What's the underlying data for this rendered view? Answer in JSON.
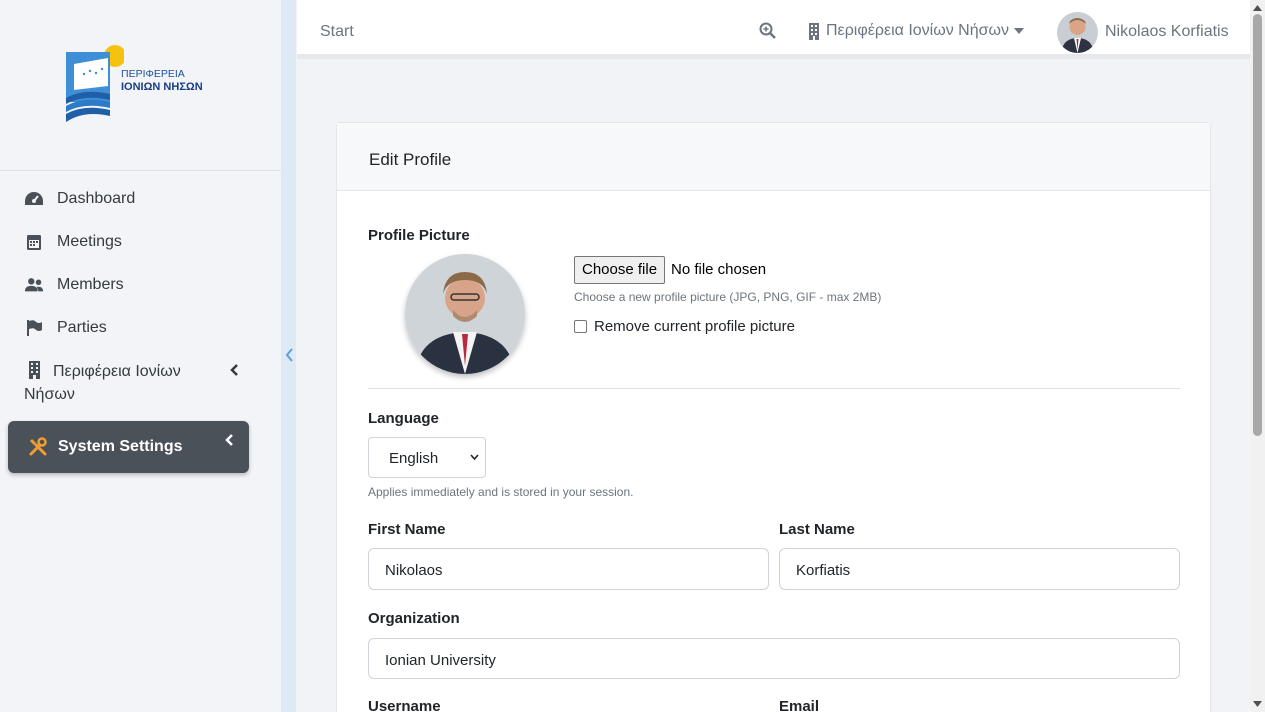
{
  "logo": {
    "line1": "ΠΕΡΙΦΕΡΕΙΑ",
    "line2": "ΙΟΝΙΩΝ ΝΗΣΩΝ"
  },
  "sidebar": {
    "items": [
      {
        "label": "Dashboard",
        "icon": "tachometer-icon"
      },
      {
        "label": "Meetings",
        "icon": "calendar-icon"
      },
      {
        "label": "Members",
        "icon": "users-icon"
      },
      {
        "label": "Parties",
        "icon": "flag-icon"
      }
    ],
    "region_item": {
      "label_line1": "Περιφέρεια Ιονίων",
      "label_line2": "Νήσων",
      "icon": "building-icon"
    },
    "active_item": {
      "label": "System Settings",
      "icon": "tools-icon"
    }
  },
  "topbar": {
    "start": "Start",
    "region": "Περιφέρεια Ιονίων Νήσων",
    "username": "Nikolaos Korfiatis"
  },
  "card": {
    "title": "Edit Profile",
    "profile_picture_label": "Profile Picture",
    "choose_file": "Choose file",
    "file_status": "No file chosen",
    "file_help": "Choose a new profile picture (JPG, PNG, GIF - max 2MB)",
    "remove_label": "Remove current profile picture",
    "language_label": "Language",
    "language_value": "English",
    "language_help": "Applies immediately and is stored in your session.",
    "first_name_label": "First Name",
    "first_name_value": "Nikolaos",
    "last_name_label": "Last Name",
    "last_name_value": "Korfiatis",
    "organization_label": "Organization",
    "organization_value": "Ionian University",
    "username_label": "Username",
    "email_label": "Email"
  },
  "colors": {
    "active_nav_bg": "#4a5158",
    "active_icon": "#f0a030",
    "sidebar_bg": "#f2f4f7"
  }
}
